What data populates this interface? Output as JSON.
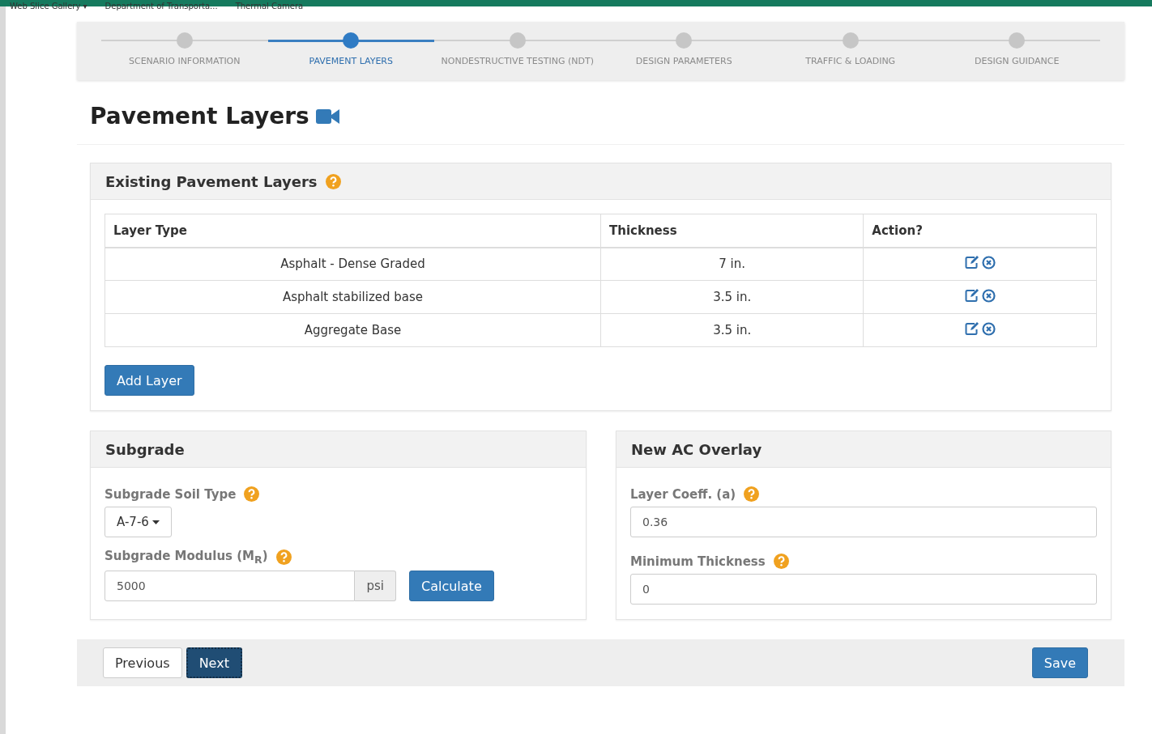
{
  "favorites_bar": [
    {
      "label": "Web Slice Gallery ▾"
    },
    {
      "label": "Department of Transporta..."
    },
    {
      "label": "Thermal Camera"
    }
  ],
  "steps": [
    {
      "label": "SCENARIO INFORMATION",
      "selected": false
    },
    {
      "label": "PAVEMENT LAYERS",
      "selected": true
    },
    {
      "label": "NONDESTRUCTIVE TESTING (NDT)",
      "selected": false
    },
    {
      "label": "DESIGN PARAMETERS",
      "selected": false
    },
    {
      "label": "TRAFFIC & LOADING",
      "selected": false
    },
    {
      "label": "DESIGN GUIDANCE",
      "selected": false
    }
  ],
  "page_title": "Pavement Layers",
  "existing_layers": {
    "title": "Existing Pavement Layers",
    "columns": [
      "Layer Type",
      "Thickness",
      "Action?"
    ],
    "rows": [
      {
        "layer_type": "Asphalt - Dense Graded",
        "thickness": "7 in."
      },
      {
        "layer_type": "Asphalt stabilized base",
        "thickness": "3.5 in."
      },
      {
        "layer_type": "Aggregate Base",
        "thickness": "3.5 in."
      }
    ],
    "add_button": "Add Layer"
  },
  "subgrade": {
    "title": "Subgrade",
    "soil_type_label": "Subgrade Soil Type",
    "soil_type_value": "A-7-6",
    "modulus_label": "Subgrade Modulus (M$_{R}$)",
    "modulus_value": "5000",
    "modulus_unit": "psi",
    "calculate_button": "Calculate"
  },
  "overlay": {
    "title": "New AC Overlay",
    "coeff_label": "Layer Coeff. (a)",
    "coeff_value": "0.36",
    "min_thickness_label": "Minimum Thickness",
    "min_thickness_value": "0"
  },
  "footer": {
    "previous": "Previous",
    "next": "Next",
    "save": "Save"
  }
}
